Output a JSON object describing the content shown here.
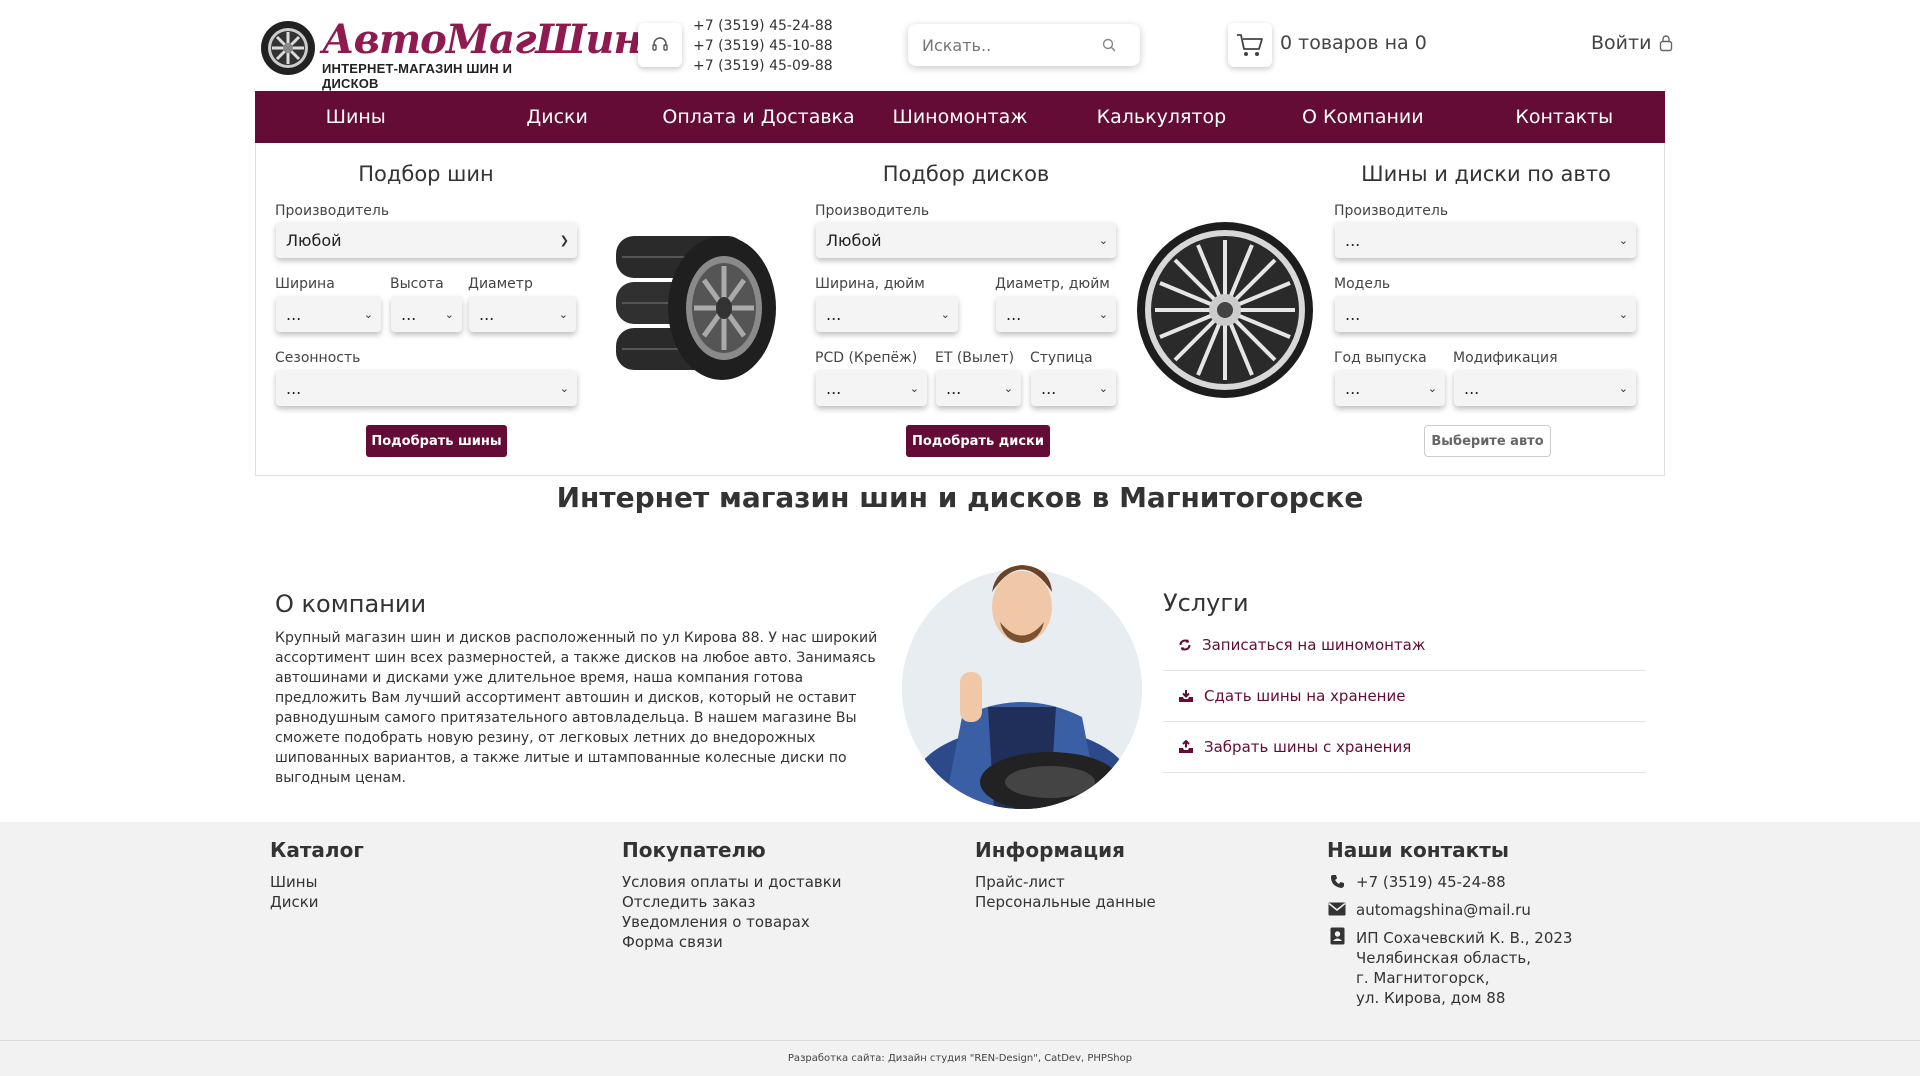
{
  "header": {
    "logo_title": "АвтоМагШина",
    "logo_subtitle": "ИНТЕРНЕТ-МАГАЗИН ШИН И ДИСКОВ",
    "phones": [
      "+7 (3519) 45-24-88",
      "+7 (3519) 45-10-88",
      "+7 (3519) 45-09-88"
    ],
    "search_placeholder": "Искать..",
    "cart_text": "0 товаров на 0",
    "login_label": "Войти"
  },
  "nav": {
    "items": [
      "Шины",
      "Диски",
      "Оплата и Доставка",
      "Шиномонтаж",
      "Калькулятор",
      "О Компании",
      "Контакты"
    ]
  },
  "tyres": {
    "title": "Подбор шин",
    "manufacturer_label": "Производитель",
    "manufacturer_value": "Любой",
    "width_label": "Ширина",
    "height_label": "Высота",
    "diameter_label": "Диаметр",
    "season_label": "Сезонность",
    "empty_value": "...",
    "button": "Подобрать шины"
  },
  "discs": {
    "title": "Подбор дисков",
    "manufacturer_label": "Производитель",
    "manufacturer_value": "Любой",
    "width_label": "Ширина, дюйм",
    "diameter_label": "Диаметр, дюйм",
    "pcd_label": "PCD (Крепёж)",
    "et_label": "ET (Вылет)",
    "hub_label": "Ступица",
    "empty_value": "...",
    "button": "Подобрать диски"
  },
  "byauto": {
    "title": "Шины и диски по авто",
    "manufacturer_label": "Производитель",
    "model_label": "Модель",
    "year_label": "Год выпуска",
    "modification_label": "Модификация",
    "empty_value": "...",
    "button": "Выберите авто"
  },
  "main": {
    "heading": "Интернет магазин шин и дисков в Магнитогорске",
    "about_title": "О компании",
    "about_text": "Крупный магазин шин и дисков расположенный по ул Кирова 88. У нас широкий ассортимент шин всех размерностей, а также дисков на любое авто. Занимаясь автошинами и дисками уже длительное время, наша компания готова предложить Вам лучший ассортимент автошин и дисков, который не оставит равнодушным самого притязательного автовладельца. В нашем магазине Вы сможете подобрать новую резину, от легковых летних до внедорожных шипованных вариантов, а также литые и штампованные колесные диски по выгодным ценам.",
    "services_title": "Услуги",
    "services": [
      "Записаться на шиномонтаж",
      "Сдать шины на хранение",
      "Забрать шины с хранения"
    ]
  },
  "footer": {
    "catalog_title": "Каталог",
    "catalog_links": [
      "Шины",
      "Диски"
    ],
    "buyer_title": "Покупателю",
    "buyer_links": [
      "Условия оплаты и доставки",
      "Отследить заказ",
      "Уведомления о товарах",
      "Форма связи"
    ],
    "info_title": "Информация",
    "info_links": [
      "Прайс-лист",
      "Персональные данные"
    ],
    "contacts_title": "Наши контакты",
    "phone": "+7 (3519) 45-24-88",
    "email": "automagshina@mail.ru",
    "address_lines": [
      "ИП Сохачевский К. В., 2023",
      "Челябинская область,",
      "г. Магнитогорск,",
      "ул. Кирова, дом 88"
    ],
    "credits": "Разработка сайта: Дизайн студия \"REN-Design\", CatDev, PHPShop"
  },
  "colors": {
    "brand": "#640b36",
    "logo": "#8e1a4f",
    "footer_bg": "#f2f2f2"
  }
}
